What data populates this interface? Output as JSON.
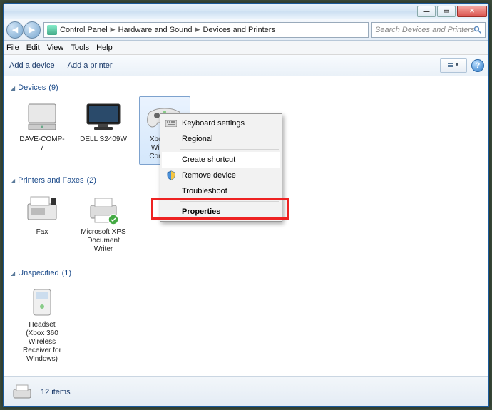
{
  "titlebar": {
    "min": "—",
    "max": "▭",
    "close": "✕"
  },
  "nav": {
    "back": "◀",
    "forward": "▶"
  },
  "breadcrumb": {
    "items": [
      "Control Panel",
      "Hardware and Sound",
      "Devices and Printers"
    ]
  },
  "search": {
    "placeholder": "Search Devices and Printers"
  },
  "menubar": {
    "file": "File",
    "edit": "Edit",
    "view": "View",
    "tools": "Tools",
    "help": "Help"
  },
  "toolbar": {
    "add_device": "Add a device",
    "add_printer": "Add a printer"
  },
  "categories": {
    "devices": {
      "label": "Devices",
      "count": "(9)"
    },
    "printers": {
      "label": "Printers and Faxes",
      "count": "(2)"
    },
    "unspecified": {
      "label": "Unspecified",
      "count": "(1)"
    }
  },
  "devices_items": [
    {
      "label": "DAVE-COMP-7"
    },
    {
      "label": "DELL S2409W"
    },
    {
      "label": "Xbox 360 Wireless Controller"
    }
  ],
  "printers_items": [
    {
      "label": "Fax"
    },
    {
      "label": "Microsoft XPS Document Writer"
    }
  ],
  "unspecified_items": [
    {
      "label": "Headset (Xbox 360 Wireless Receiver for Windows)"
    }
  ],
  "context_menu": {
    "keyboard": "Keyboard settings",
    "regional": "Regional",
    "create_shortcut": "Create shortcut",
    "remove_device": "Remove device",
    "troubleshoot": "Troubleshoot",
    "properties": "Properties"
  },
  "statusbar": {
    "count": "12 items"
  }
}
